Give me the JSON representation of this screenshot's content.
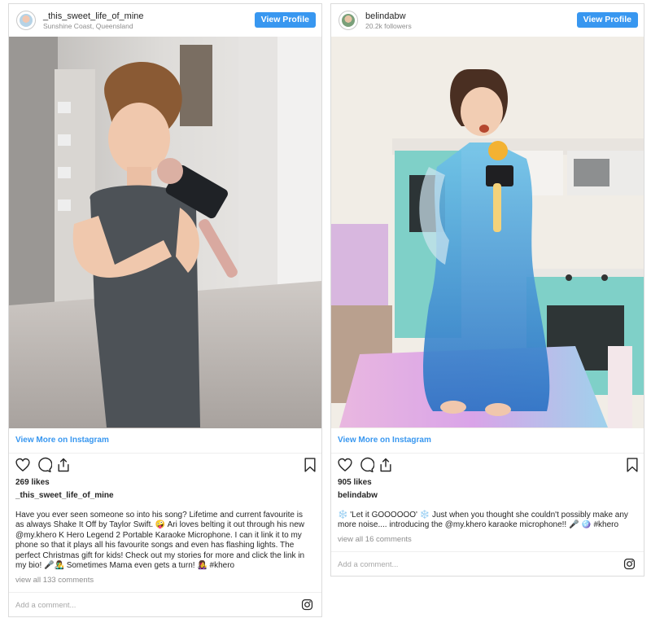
{
  "posts": [
    {
      "username": "_this_sweet_life_of_mine",
      "subtitle": "Sunshine Coast, Queensland",
      "view_profile": "View Profile",
      "view_more": "View More on Instagram",
      "likes": "269 likes",
      "owner": "_this_sweet_life_of_mine",
      "caption": "Have you ever seen someone so into his song? Lifetime and current favourite is as always Shake It Off by Taylor Swift. 🤪 Ari loves belting it out through his new @my.khero K Hero Legend 2 Portable Karaoke Microphone. I can it link it to my phone so that it plays all his favourite songs and even has flashing lights. The perfect Christmas gift for kids! Check out my stories for more and click the link in my bio! 🎤👨‍🎤 Sometimes Mama even gets a turn! 👩‍🎤 #khero",
      "view_comments": "view all 133 comments",
      "add_comment": "Add a comment..."
    },
    {
      "username": "belindabw",
      "subtitle": "20.2k followers",
      "view_profile": "View Profile",
      "view_more": "View More on Instagram",
      "likes": "905 likes",
      "owner": "belindabw",
      "caption": "❄️ 'Let it GOOOOOO' ❄️ Just when you thought she couldn't possibly make any more noise.... introducing the @my.khero karaoke microphone!! 🎤 🪩 #khero",
      "view_comments": "view all 16 comments",
      "add_comment": "Add a comment..."
    }
  ],
  "colors": {
    "accent": "#3897f0",
    "muted": "#8e8e8e",
    "border": "#dbdbdb"
  },
  "icons": [
    "heart-icon",
    "comment-icon",
    "share-icon",
    "bookmark-icon",
    "instagram-logo-icon"
  ]
}
